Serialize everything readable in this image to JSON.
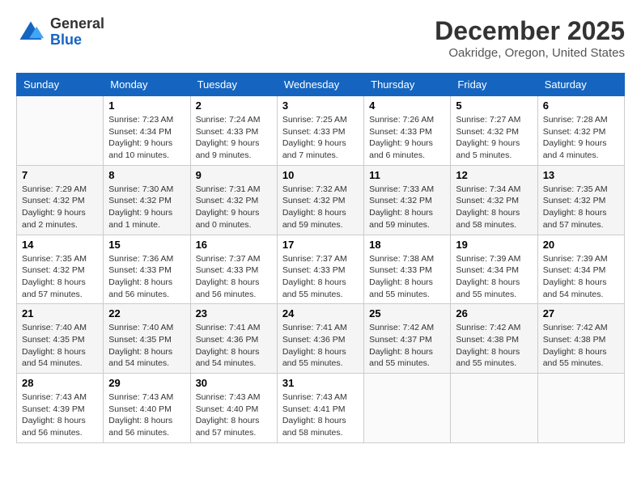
{
  "logo": {
    "general": "General",
    "blue": "Blue"
  },
  "title": {
    "month_year": "December 2025",
    "location": "Oakridge, Oregon, United States"
  },
  "weekdays": [
    "Sunday",
    "Monday",
    "Tuesday",
    "Wednesday",
    "Thursday",
    "Friday",
    "Saturday"
  ],
  "weeks": [
    [
      {
        "day": "",
        "sunrise": "",
        "sunset": "",
        "daylight": ""
      },
      {
        "day": "1",
        "sunrise": "Sunrise: 7:23 AM",
        "sunset": "Sunset: 4:34 PM",
        "daylight": "Daylight: 9 hours and 10 minutes."
      },
      {
        "day": "2",
        "sunrise": "Sunrise: 7:24 AM",
        "sunset": "Sunset: 4:33 PM",
        "daylight": "Daylight: 9 hours and 9 minutes."
      },
      {
        "day": "3",
        "sunrise": "Sunrise: 7:25 AM",
        "sunset": "Sunset: 4:33 PM",
        "daylight": "Daylight: 9 hours and 7 minutes."
      },
      {
        "day": "4",
        "sunrise": "Sunrise: 7:26 AM",
        "sunset": "Sunset: 4:33 PM",
        "daylight": "Daylight: 9 hours and 6 minutes."
      },
      {
        "day": "5",
        "sunrise": "Sunrise: 7:27 AM",
        "sunset": "Sunset: 4:32 PM",
        "daylight": "Daylight: 9 hours and 5 minutes."
      },
      {
        "day": "6",
        "sunrise": "Sunrise: 7:28 AM",
        "sunset": "Sunset: 4:32 PM",
        "daylight": "Daylight: 9 hours and 4 minutes."
      }
    ],
    [
      {
        "day": "7",
        "sunrise": "Sunrise: 7:29 AM",
        "sunset": "Sunset: 4:32 PM",
        "daylight": "Daylight: 9 hours and 2 minutes."
      },
      {
        "day": "8",
        "sunrise": "Sunrise: 7:30 AM",
        "sunset": "Sunset: 4:32 PM",
        "daylight": "Daylight: 9 hours and 1 minute."
      },
      {
        "day": "9",
        "sunrise": "Sunrise: 7:31 AM",
        "sunset": "Sunset: 4:32 PM",
        "daylight": "Daylight: 9 hours and 0 minutes."
      },
      {
        "day": "10",
        "sunrise": "Sunrise: 7:32 AM",
        "sunset": "Sunset: 4:32 PM",
        "daylight": "Daylight: 8 hours and 59 minutes."
      },
      {
        "day": "11",
        "sunrise": "Sunrise: 7:33 AM",
        "sunset": "Sunset: 4:32 PM",
        "daylight": "Daylight: 8 hours and 59 minutes."
      },
      {
        "day": "12",
        "sunrise": "Sunrise: 7:34 AM",
        "sunset": "Sunset: 4:32 PM",
        "daylight": "Daylight: 8 hours and 58 minutes."
      },
      {
        "day": "13",
        "sunrise": "Sunrise: 7:35 AM",
        "sunset": "Sunset: 4:32 PM",
        "daylight": "Daylight: 8 hours and 57 minutes."
      }
    ],
    [
      {
        "day": "14",
        "sunrise": "Sunrise: 7:35 AM",
        "sunset": "Sunset: 4:32 PM",
        "daylight": "Daylight: 8 hours and 57 minutes."
      },
      {
        "day": "15",
        "sunrise": "Sunrise: 7:36 AM",
        "sunset": "Sunset: 4:33 PM",
        "daylight": "Daylight: 8 hours and 56 minutes."
      },
      {
        "day": "16",
        "sunrise": "Sunrise: 7:37 AM",
        "sunset": "Sunset: 4:33 PM",
        "daylight": "Daylight: 8 hours and 56 minutes."
      },
      {
        "day": "17",
        "sunrise": "Sunrise: 7:37 AM",
        "sunset": "Sunset: 4:33 PM",
        "daylight": "Daylight: 8 hours and 55 minutes."
      },
      {
        "day": "18",
        "sunrise": "Sunrise: 7:38 AM",
        "sunset": "Sunset: 4:33 PM",
        "daylight": "Daylight: 8 hours and 55 minutes."
      },
      {
        "day": "19",
        "sunrise": "Sunrise: 7:39 AM",
        "sunset": "Sunset: 4:34 PM",
        "daylight": "Daylight: 8 hours and 55 minutes."
      },
      {
        "day": "20",
        "sunrise": "Sunrise: 7:39 AM",
        "sunset": "Sunset: 4:34 PM",
        "daylight": "Daylight: 8 hours and 54 minutes."
      }
    ],
    [
      {
        "day": "21",
        "sunrise": "Sunrise: 7:40 AM",
        "sunset": "Sunset: 4:35 PM",
        "daylight": "Daylight: 8 hours and 54 minutes."
      },
      {
        "day": "22",
        "sunrise": "Sunrise: 7:40 AM",
        "sunset": "Sunset: 4:35 PM",
        "daylight": "Daylight: 8 hours and 54 minutes."
      },
      {
        "day": "23",
        "sunrise": "Sunrise: 7:41 AM",
        "sunset": "Sunset: 4:36 PM",
        "daylight": "Daylight: 8 hours and 54 minutes."
      },
      {
        "day": "24",
        "sunrise": "Sunrise: 7:41 AM",
        "sunset": "Sunset: 4:36 PM",
        "daylight": "Daylight: 8 hours and 55 minutes."
      },
      {
        "day": "25",
        "sunrise": "Sunrise: 7:42 AM",
        "sunset": "Sunset: 4:37 PM",
        "daylight": "Daylight: 8 hours and 55 minutes."
      },
      {
        "day": "26",
        "sunrise": "Sunrise: 7:42 AM",
        "sunset": "Sunset: 4:38 PM",
        "daylight": "Daylight: 8 hours and 55 minutes."
      },
      {
        "day": "27",
        "sunrise": "Sunrise: 7:42 AM",
        "sunset": "Sunset: 4:38 PM",
        "daylight": "Daylight: 8 hours and 55 minutes."
      }
    ],
    [
      {
        "day": "28",
        "sunrise": "Sunrise: 7:43 AM",
        "sunset": "Sunset: 4:39 PM",
        "daylight": "Daylight: 8 hours and 56 minutes."
      },
      {
        "day": "29",
        "sunrise": "Sunrise: 7:43 AM",
        "sunset": "Sunset: 4:40 PM",
        "daylight": "Daylight: 8 hours and 56 minutes."
      },
      {
        "day": "30",
        "sunrise": "Sunrise: 7:43 AM",
        "sunset": "Sunset: 4:40 PM",
        "daylight": "Daylight: 8 hours and 57 minutes."
      },
      {
        "day": "31",
        "sunrise": "Sunrise: 7:43 AM",
        "sunset": "Sunset: 4:41 PM",
        "daylight": "Daylight: 8 hours and 58 minutes."
      },
      {
        "day": "",
        "sunrise": "",
        "sunset": "",
        "daylight": ""
      },
      {
        "day": "",
        "sunrise": "",
        "sunset": "",
        "daylight": ""
      },
      {
        "day": "",
        "sunrise": "",
        "sunset": "",
        "daylight": ""
      }
    ]
  ]
}
